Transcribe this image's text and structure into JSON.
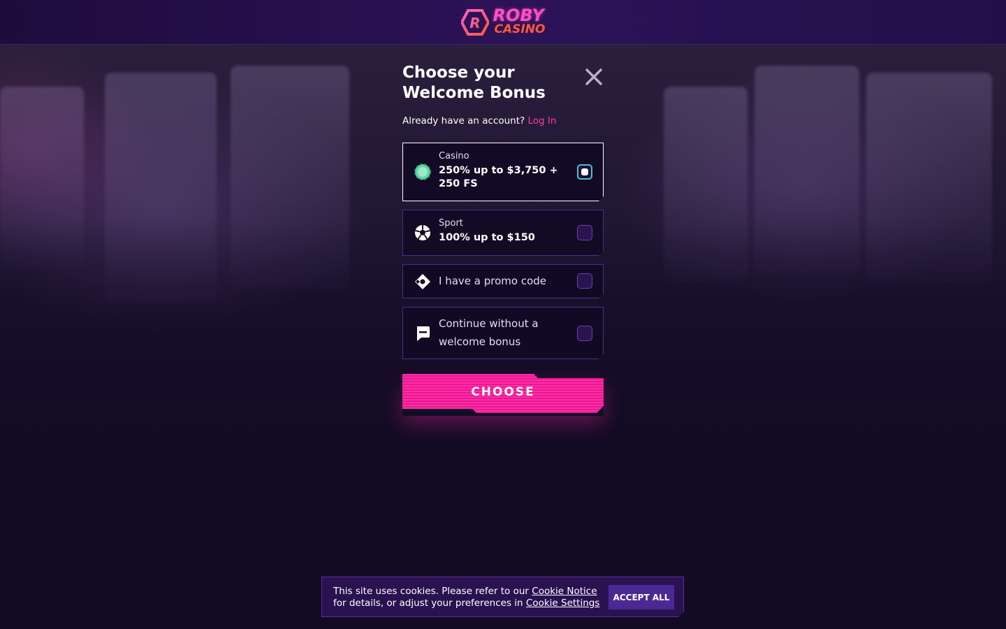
{
  "header": {
    "logo_line1": "ROBY",
    "logo_line2": "CASINO"
  },
  "modal": {
    "title": "Choose your Welcome Bonus",
    "account_prompt": "Already have an account?",
    "login_link": "Log In",
    "options": [
      {
        "icon": "casino-chip-icon",
        "label": "Casino",
        "value": "250% up to $3,750 + 250 FS",
        "selected": true
      },
      {
        "icon": "soccer-ball-icon",
        "label": "Sport",
        "value": "100% up to $150",
        "selected": false
      },
      {
        "icon": "promo-tag-icon",
        "label": "I have a promo code",
        "selected": false
      },
      {
        "icon": "no-bonus-icon",
        "label": "Continue without a welcome bonus",
        "selected": false
      }
    ],
    "choose_label": "CHOOSE",
    "close_icon": "close-icon"
  },
  "cookie": {
    "text_before": "This site uses cookies. Please refer to our ",
    "link1": "Cookie Notice",
    "text_middle": " for details, or adjust your preferences in ",
    "link2": "Cookie Settings",
    "accept_label": "ACCEPT ALL"
  },
  "colors": {
    "accent_pink": "#ff2ea6",
    "link_pink": "#ff3aa8",
    "checkbox_selected": "#4dc0d6",
    "chip_green": "#5fd3a3",
    "cookie_bg": "#2a1250"
  }
}
